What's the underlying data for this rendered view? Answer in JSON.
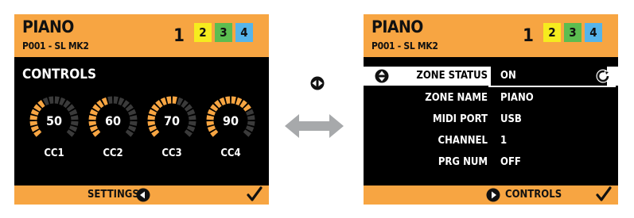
{
  "left_screen": {
    "title": "PIANO",
    "preset": "P001 - SL MK2",
    "active_zone": "1",
    "zones": [
      "2",
      "3",
      "4"
    ],
    "zone_colors": [
      "#f6ec1e",
      "#5cbd50",
      "#56b4ea"
    ],
    "section_title": "CONTROLS",
    "knobs": [
      {
        "value": "50",
        "label": "CC1",
        "level": 0.39
      },
      {
        "value": "60",
        "label": "CC2",
        "level": 0.47
      },
      {
        "value": "70",
        "label": "CC3",
        "level": 0.55
      },
      {
        "value": "90",
        "label": "CC4",
        "level": 0.71
      }
    ],
    "footer_label": "SETTINGS"
  },
  "right_screen": {
    "title": "PIANO",
    "preset": "P001 - SL MK2",
    "active_zone": "1",
    "zones": [
      "2",
      "3",
      "4"
    ],
    "rows": [
      {
        "label": "ZONE STATUS",
        "value": "ON"
      },
      {
        "label": "ZONE NAME",
        "value": "PIANO"
      },
      {
        "label": "MIDI PORT",
        "value": "USB"
      },
      {
        "label": "CHANNEL",
        "value": "1"
      },
      {
        "label": "PRG NUM",
        "value": "OFF"
      }
    ],
    "footer_label": "CONTROLS"
  },
  "colors": {
    "accent": "#f7a542",
    "knob_track": "#3a3a3a",
    "arrow_gray": "#a7a9ab"
  },
  "icons": {
    "navigate": "left-right-circle-icon",
    "swap": "double-arrow-icon",
    "confirm": "check-icon",
    "scroll": "up-down-circle-icon",
    "rotary": "rotary-encoder-icon"
  }
}
